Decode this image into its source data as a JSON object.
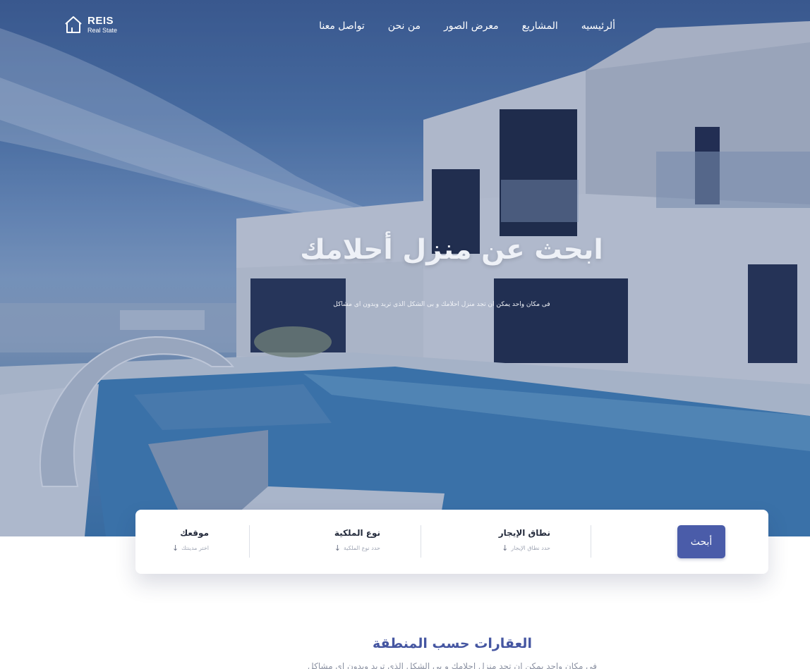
{
  "brand": {
    "name": "REIS",
    "tagline": "Real State"
  },
  "nav": {
    "items": [
      {
        "label": "ألرئيسيه"
      },
      {
        "label": "المشاريع"
      },
      {
        "label": "معرض الصور"
      },
      {
        "label": "من نحن"
      },
      {
        "label": "تواصل معنا"
      }
    ]
  },
  "hero": {
    "title": "ابحث عن منزل أحلامك",
    "subtitle": "فى مكان واحد يمكن ان تجد منزل احلامك و بى الشكل الذى تريد وبدون اى مشاكل"
  },
  "search": {
    "button_label": "أبحث",
    "fields": [
      {
        "label": "نطاق الإيجار",
        "hint": "حدد نطاق الإيجار"
      },
      {
        "label": "نوع الملكية",
        "hint": "حدد نوع الملكية"
      },
      {
        "label": "موقعك",
        "hint": "اختر مدينتك"
      }
    ]
  },
  "section": {
    "title": "العقارات حسب المنطقة",
    "subtitle": "فى مكان واحد يمكن ان تجد منزل احلامك و بى الشكل الذى تريد وبدون اى مشاكل"
  },
  "colors": {
    "accent": "#4a5ca9",
    "section_title": "#4556a1",
    "hero_overlay": "#3e5f95"
  },
  "icons": {
    "logo": "house-outline-icon",
    "field_arrow": "arrow-down-icon"
  }
}
